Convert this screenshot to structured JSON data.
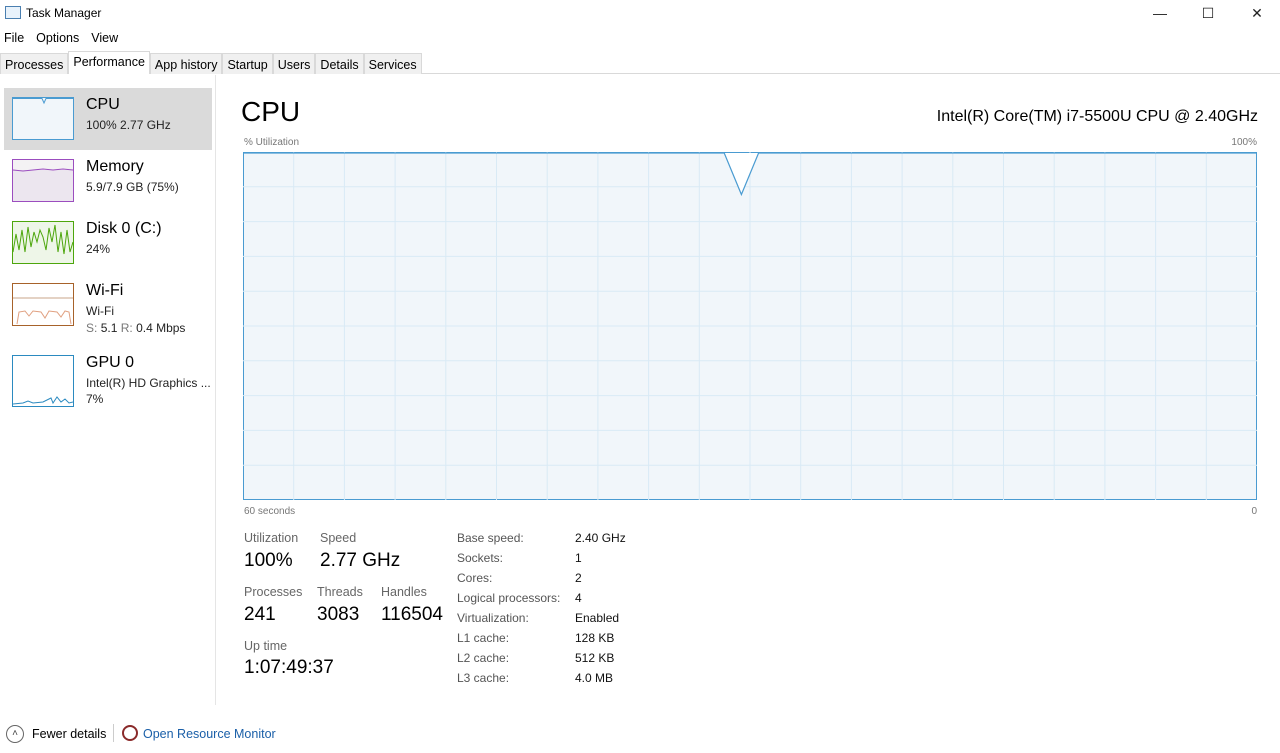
{
  "window": {
    "title": "Task Manager",
    "minimize": "—",
    "maximize": "☐",
    "close": "✕"
  },
  "menu": [
    "File",
    "Options",
    "View"
  ],
  "tabs": [
    "Processes",
    "Performance",
    "App history",
    "Startup",
    "Users",
    "Details",
    "Services"
  ],
  "sidebar": [
    {
      "name": "CPU",
      "sub1": "100%  2.77 GHz",
      "color": "#4a9bd1"
    },
    {
      "name": "Memory",
      "sub1": "5.9/7.9 GB (75%)",
      "color": "#9b4dbf"
    },
    {
      "name": "Disk 0 (C:)",
      "sub1": "24%",
      "color": "#4da60c"
    },
    {
      "name": "Wi-Fi",
      "sub1": "Wi-Fi",
      "s_label": "S:",
      "s_val": "5.1",
      "r_label": "R:",
      "r_val": "0.4 Mbps",
      "color": "#a7622a"
    },
    {
      "name": "GPU 0",
      "sub1": "Intel(R) HD Graphics ...",
      "sub2": "7%",
      "color": "#2b8ac0"
    }
  ],
  "main": {
    "title": "CPU",
    "model": "Intel(R) Core(TM) i7-5500U CPU @ 2.40GHz",
    "graph": {
      "ylabel": "% Utilization",
      "ymax": "100%",
      "xlabel": "60 seconds",
      "xmin": "0",
      "values_percent": [
        100,
        100,
        100,
        100,
        100,
        100,
        100,
        100,
        100,
        100,
        100,
        100,
        100,
        100,
        100,
        100,
        100,
        100,
        100,
        100,
        100,
        100,
        100,
        100,
        100,
        100,
        100,
        100,
        100,
        88,
        100,
        100,
        100,
        100,
        100,
        100,
        100,
        100,
        100,
        100,
        100,
        100,
        100,
        100,
        100,
        100,
        100,
        100,
        100,
        100,
        100,
        100,
        100,
        100,
        100,
        100,
        100,
        100,
        100,
        100
      ]
    },
    "stats": {
      "utilization_label": "Utilization",
      "utilization": "100%",
      "speed_label": "Speed",
      "speed": "2.77 GHz",
      "processes_label": "Processes",
      "processes": "241",
      "threads_label": "Threads",
      "threads": "3083",
      "handles_label": "Handles",
      "handles": "116504",
      "uptime_label": "Up time",
      "uptime": "1:07:49:37"
    },
    "specs": [
      {
        "k": "Base speed:",
        "v": "2.40 GHz"
      },
      {
        "k": "Sockets:",
        "v": "1"
      },
      {
        "k": "Cores:",
        "v": "2"
      },
      {
        "k": "Logical processors:",
        "v": "4"
      },
      {
        "k": "Virtualization:",
        "v": "Enabled"
      },
      {
        "k": "L1 cache:",
        "v": "128 KB"
      },
      {
        "k": "L2 cache:",
        "v": "512 KB"
      },
      {
        "k": "L3 cache:",
        "v": "4.0 MB"
      }
    ]
  },
  "footer": {
    "fewer": "Fewer details",
    "monitor": "Open Resource Monitor"
  }
}
